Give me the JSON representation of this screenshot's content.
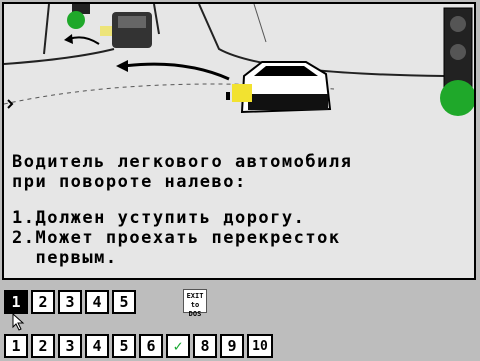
{
  "question": {
    "text_line1": "Водитель легкового автомобиля",
    "text_line2": "при повороте налево:",
    "answer1_line": "1.Должен уступить дорогу.",
    "answer2_line1": "2.Может проехать перекресток",
    "answer2_line2": "  первым."
  },
  "answer_buttons": [
    {
      "label": "1",
      "selected": true
    },
    {
      "label": "2"
    },
    {
      "label": "3"
    },
    {
      "label": "4"
    },
    {
      "label": "5"
    }
  ],
  "exit_button": {
    "line1": "EXIT",
    "line2": "to",
    "line3": "DOS"
  },
  "question_nav": [
    {
      "label": "1"
    },
    {
      "label": "2"
    },
    {
      "label": "3"
    },
    {
      "label": "4"
    },
    {
      "label": "5"
    },
    {
      "label": "6"
    },
    {
      "label": "✓",
      "checked": true
    },
    {
      "label": "8"
    },
    {
      "label": "9"
    },
    {
      "label": "10"
    }
  ],
  "colors": {
    "frame_bg": "#e6e6e6",
    "traffic_light_green": "#1fa82a",
    "turn_signal_yellow": "#f2e230",
    "check_green": "#19a832"
  }
}
